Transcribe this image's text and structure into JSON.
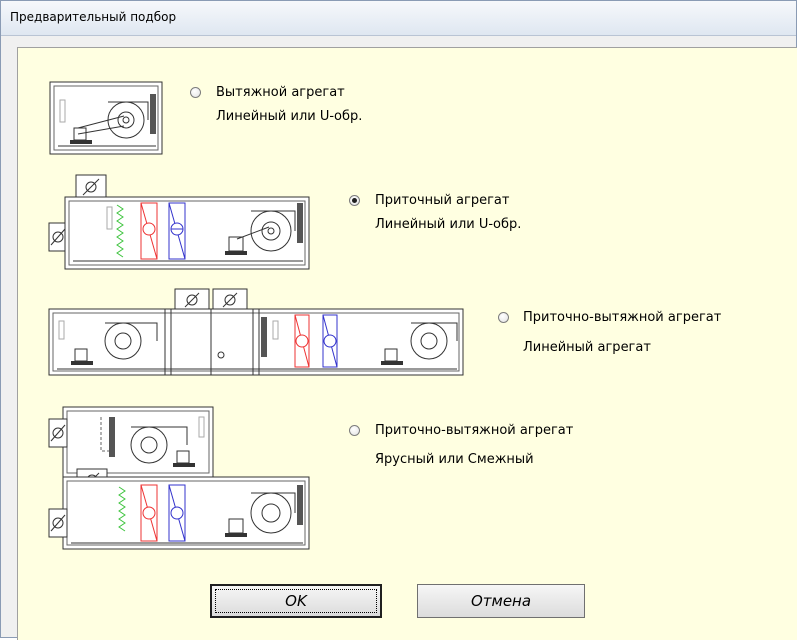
{
  "window": {
    "title": "Предварительный подбор"
  },
  "options": [
    {
      "line1": "Вытяжной агрегат",
      "line2": "Линейный или U-обр.",
      "selected": false
    },
    {
      "line1": "Приточный агрегат",
      "line2": "Линейный или U-обр.",
      "selected": true
    },
    {
      "line1": "Приточно-вытяжной агрегат",
      "line2": "Линейный агрегат",
      "selected": false
    },
    {
      "line1": "Приточно-вытяжной агрегат",
      "line2": "Ярусный или Смежный",
      "selected": false
    }
  ],
  "buttons": {
    "ok": "OK",
    "cancel": "Отмена"
  }
}
